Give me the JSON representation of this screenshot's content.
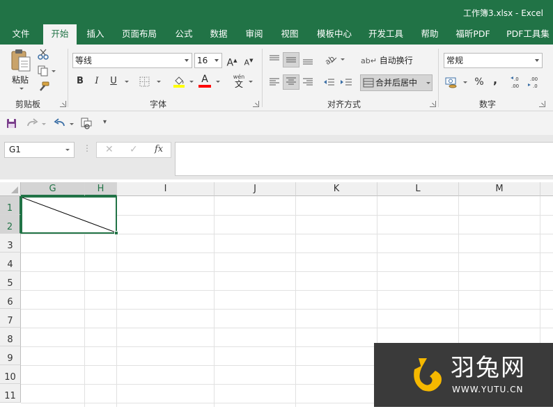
{
  "window": {
    "title": "工作簿3.xlsx  -  Excel"
  },
  "tabs": [
    {
      "label": "文件",
      "active": false
    },
    {
      "label": "开始",
      "active": true
    },
    {
      "label": "插入",
      "active": false
    },
    {
      "label": "页面布局",
      "active": false
    },
    {
      "label": "公式",
      "active": false
    },
    {
      "label": "数据",
      "active": false
    },
    {
      "label": "审阅",
      "active": false
    },
    {
      "label": "视图",
      "active": false
    },
    {
      "label": "模板中心",
      "active": false
    },
    {
      "label": "开发工具",
      "active": false
    },
    {
      "label": "帮助",
      "active": false
    },
    {
      "label": "福昕PDF",
      "active": false
    },
    {
      "label": "PDF工具集",
      "active": false
    }
  ],
  "ribbon": {
    "clipboard": {
      "label": "剪贴板",
      "paste_label": "粘贴"
    },
    "font": {
      "label": "字体",
      "font_name": "等线",
      "font_size": "16",
      "grow_label": "A",
      "shrink_label": "A",
      "bold_label": "B",
      "italic_label": "I",
      "underline_label": "U",
      "fill_color": "#ffff00",
      "font_color": "#ff0000",
      "phonetic_label": "wén",
      "phonetic_char": "文"
    },
    "alignment": {
      "label": "对齐方式",
      "wrap_label": "自动换行",
      "merge_label": "合并后居中"
    },
    "number": {
      "label": "数字",
      "format": "常规",
      "percent_label": "%",
      "comma_label": ","
    }
  },
  "formula_bar": {
    "name_box": "G1",
    "fx_label": "fx",
    "value": ""
  },
  "grid": {
    "columns": [
      "G",
      "H",
      "I",
      "J",
      "K",
      "L",
      "M"
    ],
    "selected_columns": [
      "G",
      "H"
    ],
    "rows": [
      "1",
      "2",
      "3",
      "4",
      "5",
      "6",
      "7",
      "8",
      "9",
      "10",
      "11"
    ],
    "selected_rows": [
      "1",
      "2"
    ],
    "selection_color": "#217346"
  },
  "watermark": {
    "brand": "羽兔网",
    "url": "WWW.YUTU.CN"
  }
}
